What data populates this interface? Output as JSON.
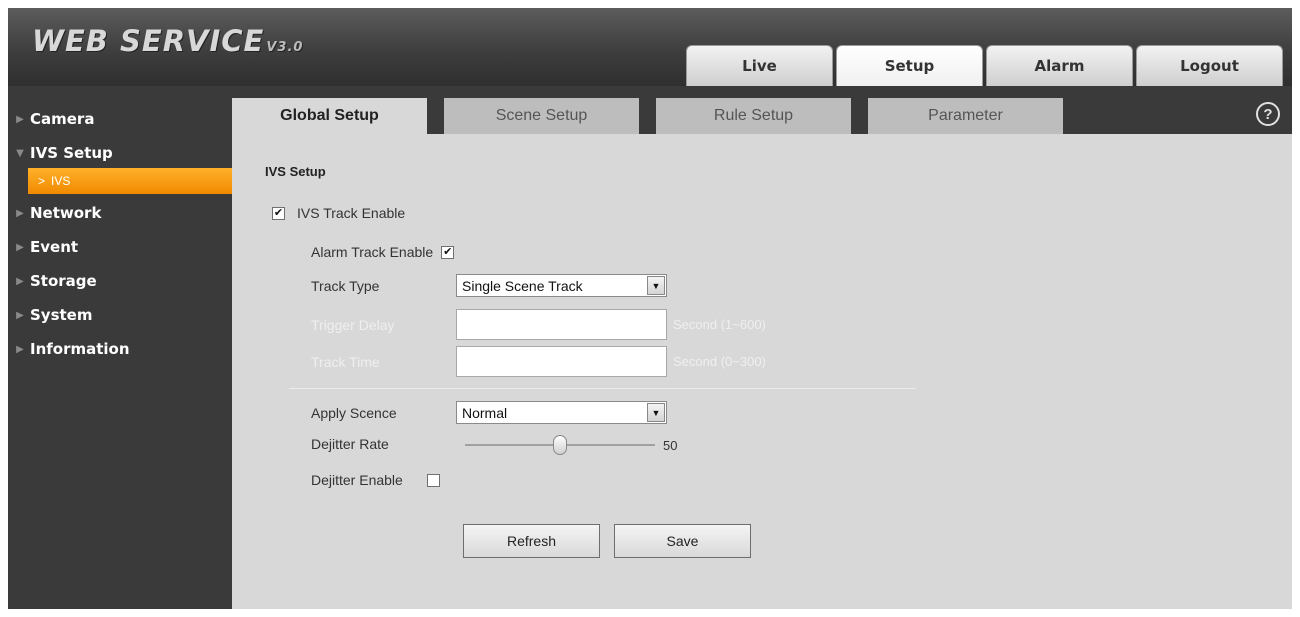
{
  "header": {
    "logo_text": "WEB  SERVICE",
    "logo_version": "V3.0",
    "nav": [
      "Live",
      "Setup",
      "Alarm",
      "Logout"
    ],
    "active_nav": "Setup"
  },
  "sidebar": {
    "items": [
      {
        "label": "Camera",
        "expanded": false
      },
      {
        "label": "IVS Setup",
        "expanded": true,
        "children": [
          {
            "label": "IVS",
            "selected": true
          }
        ]
      },
      {
        "label": "Network",
        "expanded": false
      },
      {
        "label": "Event",
        "expanded": false
      },
      {
        "label": "Storage",
        "expanded": false
      },
      {
        "label": "System",
        "expanded": false
      },
      {
        "label": "Information",
        "expanded": false
      }
    ]
  },
  "content": {
    "tabs": [
      "Global Setup",
      "Scene Setup",
      "Rule Setup",
      "Parameter"
    ],
    "active_tab": "Global Setup",
    "help_icon": "?",
    "section_title": "IVS Setup",
    "ivs_track_enable": {
      "label": "IVS Track Enable",
      "checked": true,
      "mark": "✔"
    },
    "alarm_track_enable": {
      "label": "Alarm Track Enable",
      "checked": true,
      "mark": "✔"
    },
    "track_type": {
      "label": "Track Type",
      "value": "Single Scene Track"
    },
    "trigger_delay": {
      "label": "Trigger Delay",
      "value": "",
      "unit": "Second (1~600)",
      "disabled": true
    },
    "track_time": {
      "label": "Track Time",
      "value": "",
      "unit": "Second (0~300)",
      "disabled": true
    },
    "apply_scene": {
      "label": "Apply Scence",
      "value": "Normal"
    },
    "dejitter_rate": {
      "label": "Dejitter Rate",
      "value": "50",
      "fraction": 0.5
    },
    "dejitter_enable": {
      "label": "Dejitter Enable",
      "checked": false
    },
    "buttons": {
      "refresh": "Refresh",
      "save": "Save"
    }
  },
  "colors": {
    "accent": "#f59a0c",
    "panel": "#d8d8d8",
    "chrome": "#3a3a3a"
  }
}
